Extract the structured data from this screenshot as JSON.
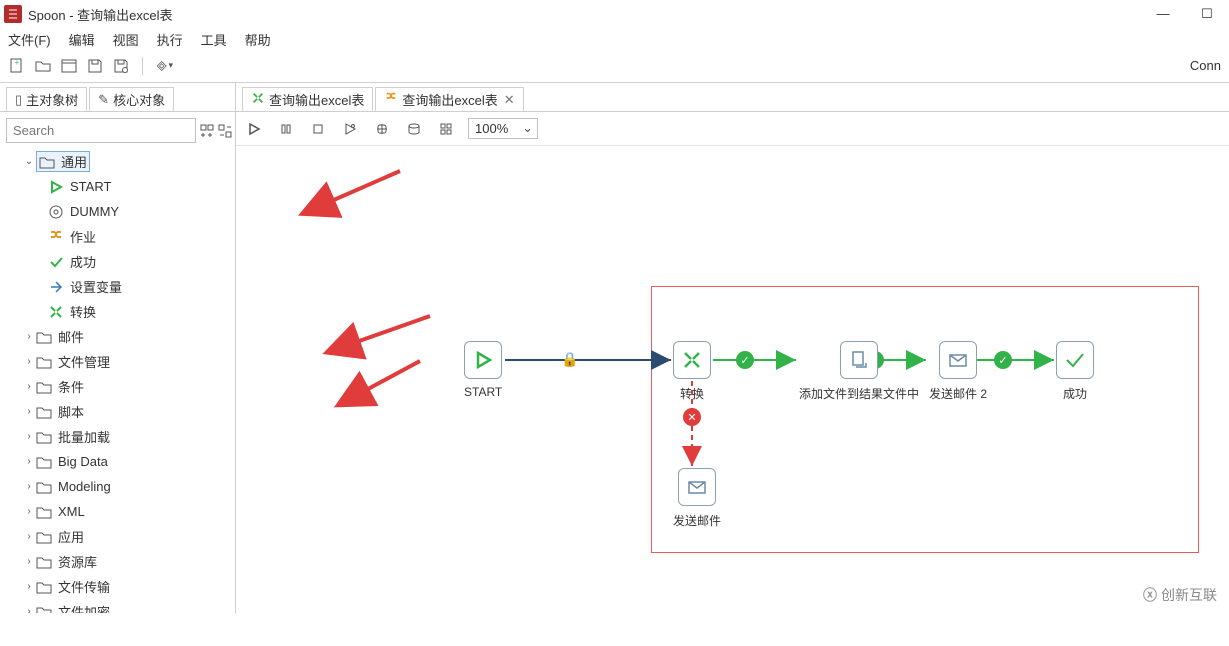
{
  "title": "Spoon - 查询输出excel表",
  "menu": [
    "文件(F)",
    "编辑",
    "视图",
    "执行",
    "工具",
    "帮助"
  ],
  "toolbar_right": "Conn",
  "left_tabs": {
    "object_tree": "主对象树",
    "core_objects": "核心对象"
  },
  "search": {
    "placeholder": "Search"
  },
  "tree": {
    "folder_general": "通用",
    "general_items": {
      "start": "START",
      "dummy": "DUMMY",
      "job": "作业",
      "success": "成功",
      "setvar": "设置变量",
      "trans": "转换"
    },
    "folders": [
      "邮件",
      "文件管理",
      "条件",
      "脚本",
      "批量加载",
      "Big Data",
      "Modeling",
      "XML",
      "应用",
      "资源库",
      "文件传输",
      "文件加密"
    ]
  },
  "editor_tabs": {
    "tab1": "查询输出excel表",
    "tab2": "查询输出excel表"
  },
  "zoom": "100%",
  "nodes": {
    "start": "START",
    "trans": "转换",
    "addfile": "添加文件到结果文件中",
    "mail2": "发送邮件 2",
    "success": "成功",
    "mail": "发送邮件"
  },
  "watermark": "创新互联"
}
